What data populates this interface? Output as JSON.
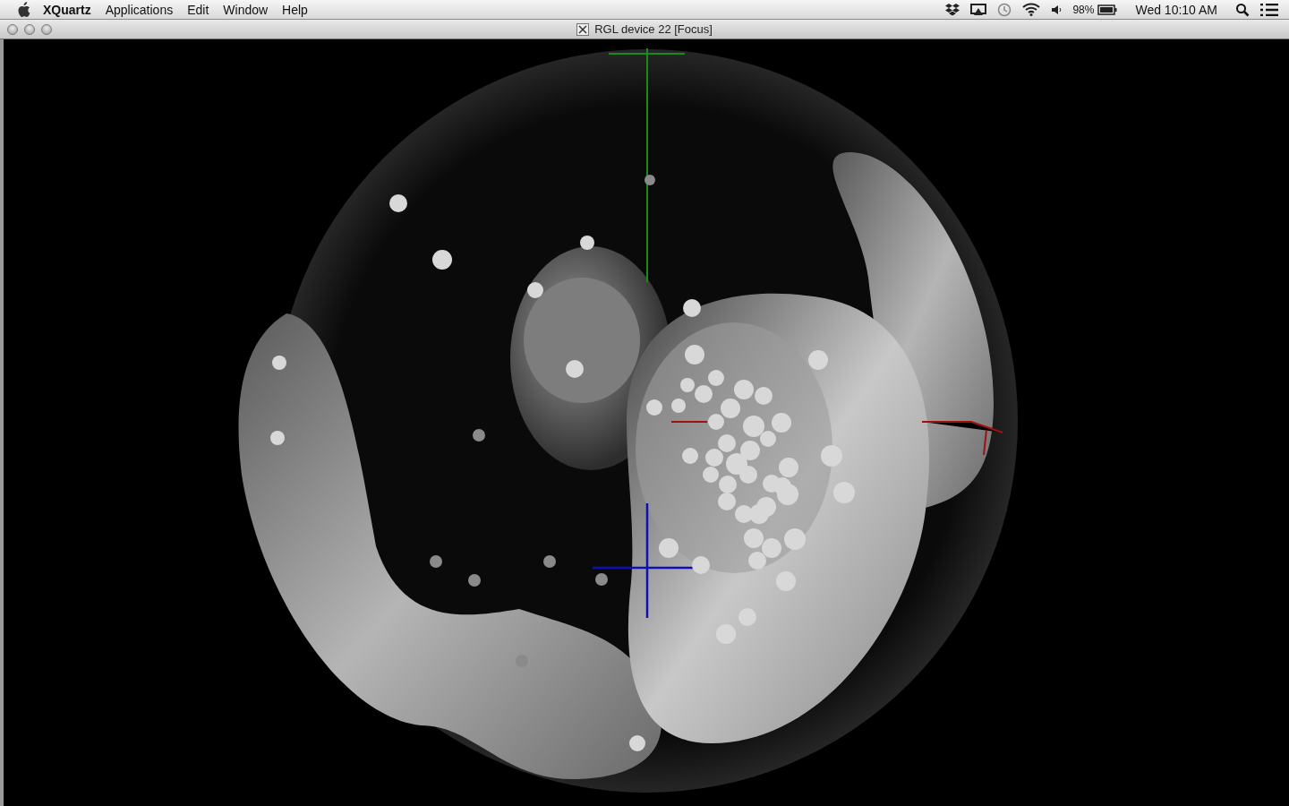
{
  "menu_bar": {
    "app_name": "XQuartz",
    "menus": [
      "Applications",
      "Edit",
      "Window",
      "Help"
    ],
    "battery": "98%",
    "clock": "Wed 10:10 AM"
  },
  "window": {
    "title": "RGL device 22 [Focus]"
  }
}
